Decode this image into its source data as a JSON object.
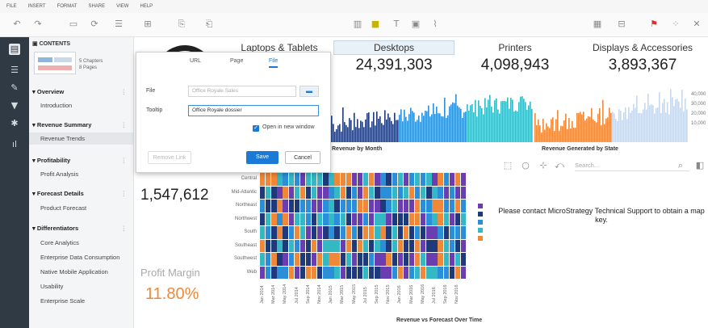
{
  "menu": {
    "items": [
      "FILE",
      "INSERT",
      "FORMAT",
      "SHARE",
      "VIEW",
      "HELP"
    ]
  },
  "toolbar": {
    "icons": [
      "undo-icon",
      "redo-icon",
      "save-icon",
      "refresh-icon",
      "data-icon",
      "add-dataset-icon",
      "add-visualization-icon",
      "filter-icon",
      "text-icon",
      "image-icon",
      "shape-icon",
      "layout-icon",
      "export-icon",
      "present-icon",
      "more-icon",
      "close-icon"
    ]
  },
  "toc": {
    "title": "CONTENTS",
    "thumb_meta": [
      "5 Chapters",
      "8 Pages"
    ],
    "chapters": [
      {
        "label": "Overview",
        "pages": [
          "Introduction"
        ]
      },
      {
        "label": "Revenue Summary",
        "pages": [
          "Revenue Trends"
        ]
      },
      {
        "label": "Profitability",
        "pages": [
          "Profit Analysis"
        ]
      },
      {
        "label": "Forecast Details",
        "pages": [
          "Product Forecast"
        ]
      },
      {
        "label": "Differentiators",
        "pages": [
          "Core Analytics",
          "Enterprise Data Consumption",
          "Native Mobile Application",
          "Usability",
          "Enterprise Scale"
        ]
      }
    ]
  },
  "kpis": [
    {
      "title": "Laptops & Tablets",
      "value": ""
    },
    {
      "title": "Desktops",
      "value": "24,391,303"
    },
    {
      "title": "Printers",
      "value": "4,098,943"
    },
    {
      "title": "Displays & Accessories",
      "value": "3,893,367"
    }
  ],
  "charts": {
    "revenue_by_month": "Revenue by Month",
    "revenue_by_state": "Revenue Generated by State",
    "heatmap_title": "Revenue vs Forecast Over Time",
    "state_ticks": [
      "40,000",
      "30,000",
      "20,000",
      "10,000"
    ]
  },
  "metric": {
    "value": "1,547,612"
  },
  "profit": {
    "label": "Profit Margin",
    "value": "11.80%"
  },
  "heatmap": {
    "rows": [
      "Central",
      "Mid-Atlantic",
      "Northeast",
      "Northwest",
      "South",
      "Southeast",
      "Southwest",
      "Web"
    ],
    "cols": [
      "Jan 2014",
      "Mar 2014",
      "May 2014",
      "Jul 2014",
      "Sep 2014",
      "Nov 2014",
      "Jan 2015",
      "Mar 2015",
      "May 2015",
      "Jul 2015",
      "Sep 2015",
      "Nov 2015",
      "Jan 2016",
      "Mar 2016",
      "May 2016",
      "Jul 2016",
      "Sep 2016",
      "Nov 2016"
    ]
  },
  "map": {
    "search_placeholder": "Search...",
    "message": "Please contact MicroStrategy Technical Support to obtain a map key."
  },
  "dialog": {
    "tabs": [
      "URL",
      "Page",
      "File"
    ],
    "active_tab": "File",
    "file_label": "File",
    "file_value": "Office Royale Sales",
    "tooltip_label": "Tooltip",
    "tooltip_value": "Office Royale dossier",
    "open_new_window": "Open in new window",
    "remove_link": "Remove Link",
    "save": "Save",
    "cancel": "Cancel"
  },
  "colors": {
    "accent": "#1a7ad6",
    "navy": "#1f3a7a",
    "purple": "#6a3db0",
    "orange": "#f0883a",
    "teal": "#33b8c4",
    "sky": "#2a8fd8",
    "rail": "#2f3a45"
  }
}
